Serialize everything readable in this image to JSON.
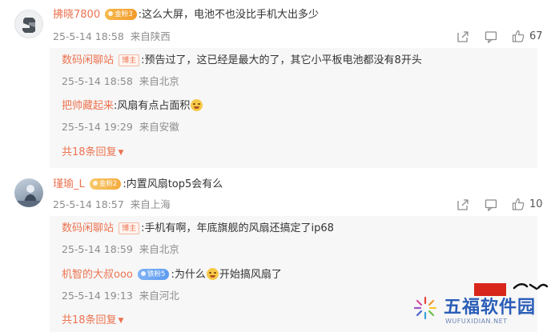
{
  "comments": [
    {
      "username": "拂晓7800",
      "badge": "金粉3",
      "text": ":这么大屏，电池不也没比手机大出多少",
      "time": "25-5-14 18:58",
      "location": "来自陕西",
      "likes": "67",
      "replies": [
        {
          "username": "数码闲聊站",
          "tag": "博主",
          "text": ":预告过了，这已经是最大的了，其它小平板电池都没有8开头",
          "time": "25-5-14 18:58",
          "location": "来自北京"
        },
        {
          "username": "把帅藏起来",
          "text": ":风扇有点占面积",
          "emoji": "grin-sweat-emoji",
          "time": "25-5-14 19:29",
          "location": "来自安徽"
        }
      ],
      "more_replies": "共18条回复"
    },
    {
      "username": "瑾瑜_L",
      "badge": "金粉2",
      "text": ":内置风扇top5会有么",
      "time": "25-5-14 18:57",
      "location": "来自上海",
      "likes": "10",
      "replies": [
        {
          "username": "数码闲聊站",
          "tag": "博主",
          "text": ":手机有啊，年底旗舰的风扇还搞定了ip68",
          "time": "25-5-14 18:59",
          "location": "来自北京"
        },
        {
          "username": "机智的大叔ooo",
          "badge": "铁粉5",
          "text_before": ":为什么",
          "emoji": "laugh-cry-emoji",
          "text_after": "开始搞风扇了",
          "time": "25-5-14 19:13",
          "location": "来自河北"
        }
      ],
      "more_replies": "共18条回复"
    }
  ],
  "watermark": {
    "title": "五福软件园",
    "subtitle": "WUFUXIDIAN.NET"
  },
  "colors": {
    "username": "#eb7350",
    "meta": "#8c8c8c",
    "reply_bg": "#f7f7f7",
    "badge_gold": "#f39a2a",
    "badge_blue": "#5c9bf0",
    "watermark_blue": "#2a5db8"
  }
}
